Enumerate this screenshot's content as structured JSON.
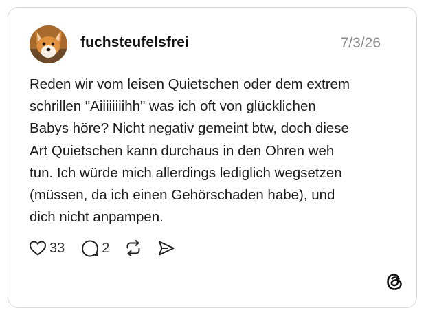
{
  "post": {
    "username": "fuchsteufelsfrei",
    "date": "7/3/26",
    "text_lines": [
      "Reden wir vom leisen Quietschen oder dem extrem",
      "schrillen \"Aiiiiiiiihh\" was ich oft von glücklichen",
      "Babys höre? Nicht negativ gemeint btw, doch diese",
      "Art Quietschen kann durchaus in den Ohren weh",
      "tun. Ich würde mich allerdings lediglich wegsetzen",
      "(müssen, da ich einen Gehörschaden habe), und",
      "dich nicht anpampen."
    ],
    "likes": "33",
    "replies": "2"
  },
  "icons": {
    "avatar": "fox-avatar",
    "like": "heart-icon",
    "reply": "comment-icon",
    "repost": "repost-icon",
    "share": "send-icon",
    "brand": "threads-logo-icon"
  },
  "colors": {
    "text": "#1c1c1c",
    "muted": "#8a8a8a",
    "border": "#d9d9d9"
  }
}
